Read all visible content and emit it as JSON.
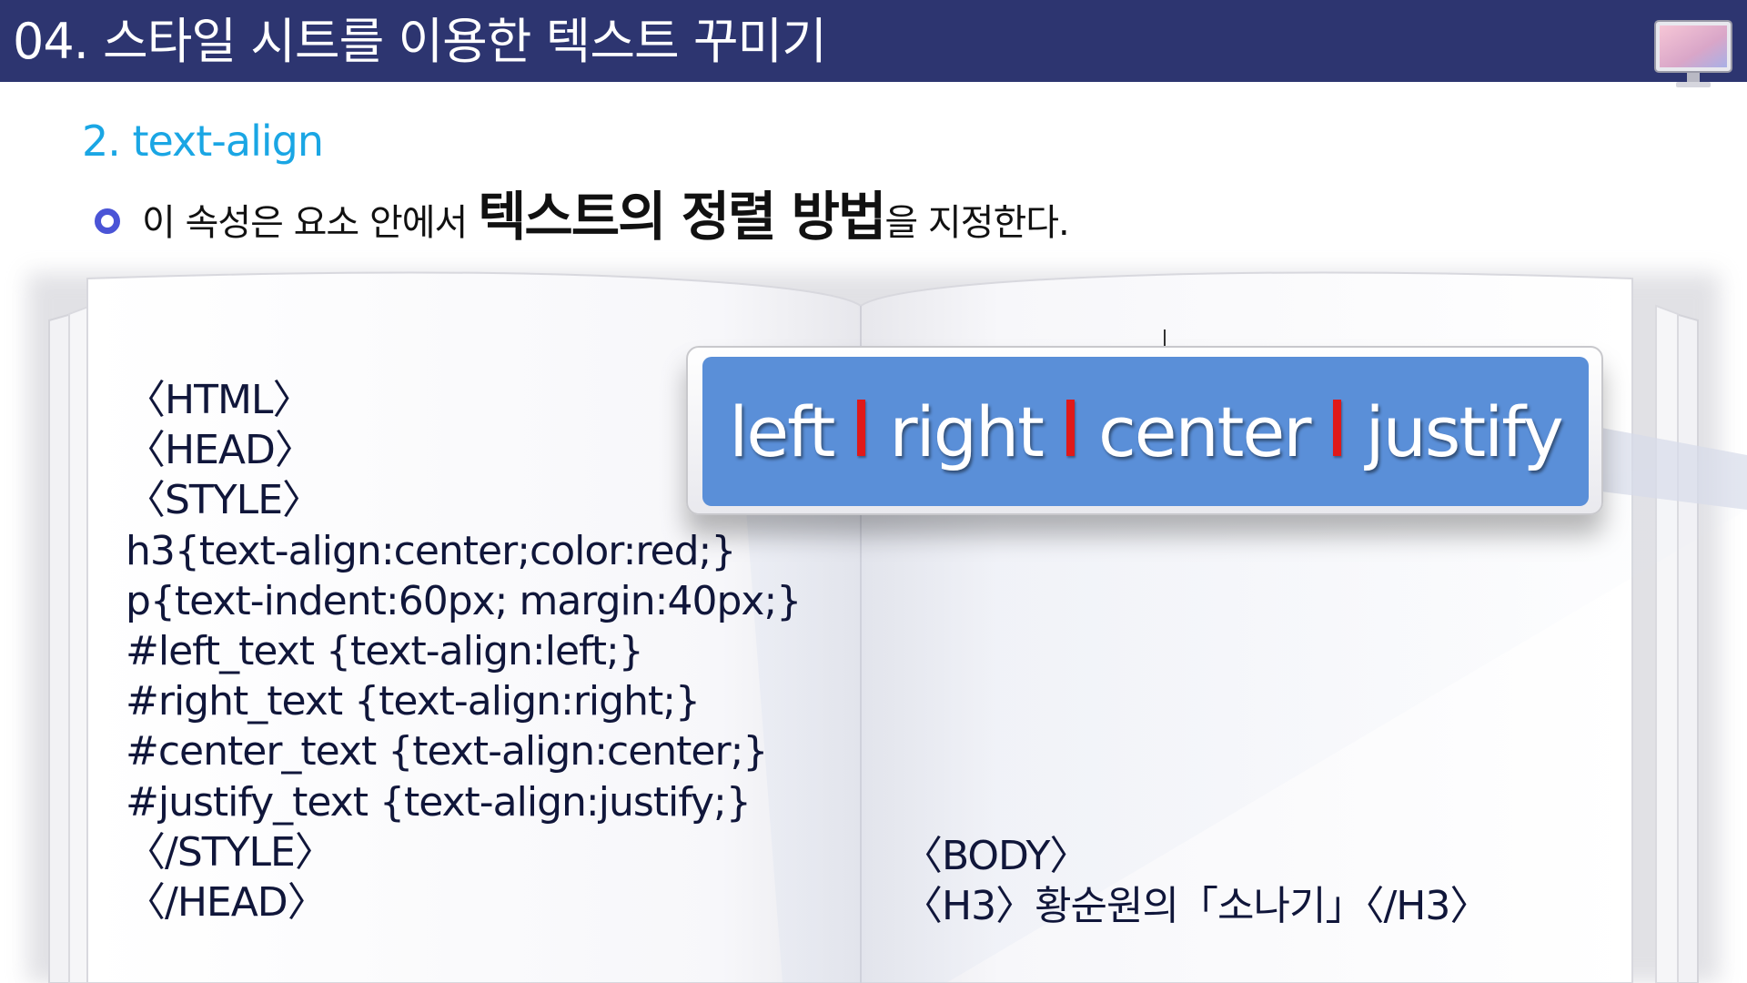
{
  "header": {
    "title": "04. 스타일 시트를 이용한 텍스트 꾸미기",
    "icon": "monitor-icon"
  },
  "section": {
    "heading": "2. text-align",
    "statement_prefix": "이 속성은 요소 안에서 ",
    "statement_emphasis": "텍스트의 정렬 방법",
    "statement_suffix": "을 지정한다."
  },
  "code": {
    "left_lines": [
      "〈HTML〉",
      "〈HEAD〉",
      "〈STYLE〉",
      "h3{text-align:center;color:red;}",
      "p{text-indent:60px; margin:40px;}",
      "#left_text {text-align:left;}",
      "#right_text {text-align:right;}",
      "#center_text {text-align:center;}",
      "#justify_text {text-align:justify;}",
      "〈/STYLE〉",
      "〈/HEAD〉"
    ],
    "right_lines": [
      "〈BODY〉",
      "〈H3〉황순원의「소나기」〈/H3〉"
    ]
  },
  "callout": {
    "values": [
      "left",
      "right",
      "center",
      "justify"
    ],
    "box_color": "#5a8fd8",
    "separator_color": "#e01919"
  },
  "colors": {
    "header_bg": "#2d3570",
    "heading": "#1aa6e4",
    "bullet": "#4a54d6"
  }
}
